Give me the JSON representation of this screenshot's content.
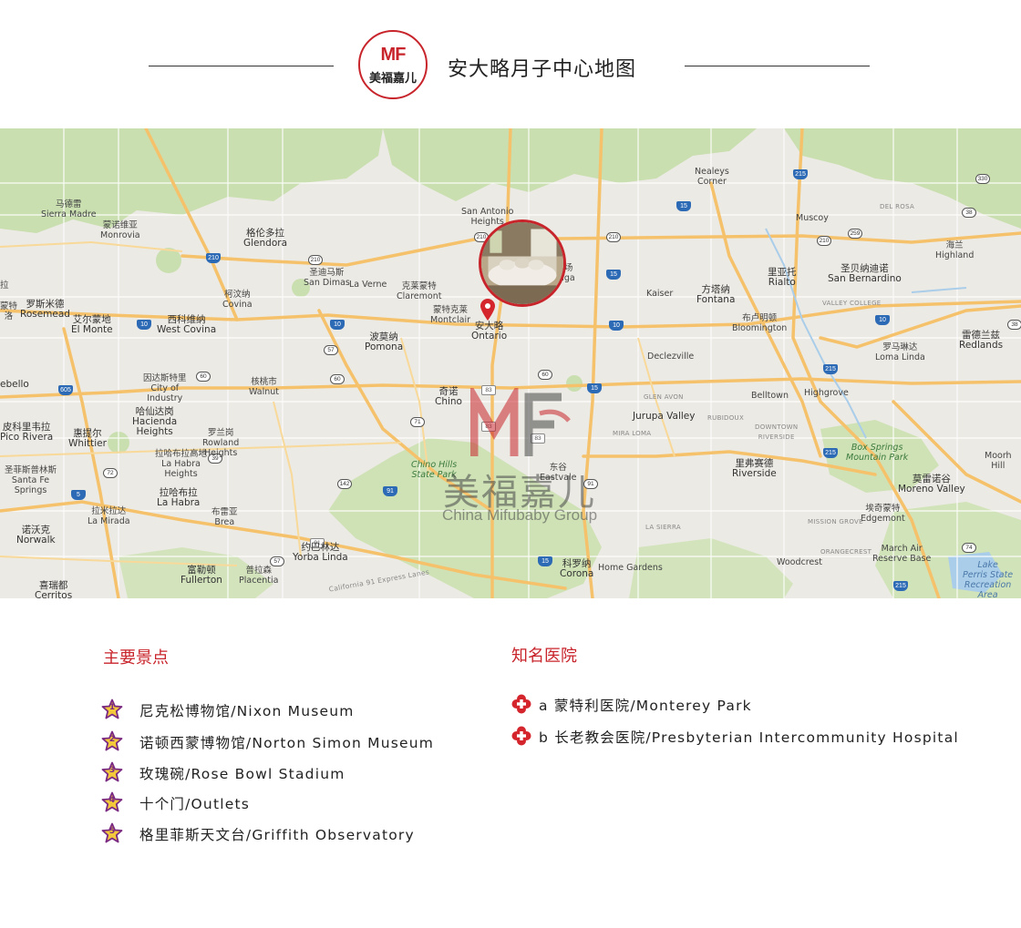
{
  "header": {
    "logo_mark": "MF",
    "logo_text": "美福嘉儿",
    "title": "安大略月子中心地图"
  },
  "map": {
    "marker_label_cn": "安大略",
    "marker_label_en": "Ontario",
    "watermark_cn": "美福嘉儿",
    "watermark_en": "China Mifubaby Group",
    "places": {
      "nealeys_corner": "Nealeys\nCorner",
      "sierra_madre": "马德雷\nSierra Madre",
      "monrovia": "蒙诺维亚\nMonrovia",
      "glendora": "格伦多拉\nGlendora",
      "san_antonio_heights": "San Antonio\nHeights",
      "muscoy": "Muscoy",
      "del_rosa": "DEL ROSA",
      "highland": "海兰\nHighland",
      "san_dimas": "圣迪马斯\nSan Dimas",
      "la_verne": "La Verne",
      "claremont": "克莱蒙特\nClaremont",
      "covina": "柯汶纳\nCovina",
      "montclair": "蒙特克莱\nMontclair",
      "upland_partial": "牧场\nonga",
      "kaiser": "Kaiser",
      "fontana": "方塔纳\nFontana",
      "rialto": "里亚托\nRialto",
      "san_bernardino": "圣贝纳迪诺\nSan Bernardino",
      "valley_college": "VALLEY COLLEGE",
      "la_puente_partial": "拉",
      "rosemead": "罗斯米德\nRosemead",
      "el_monte": "艾尔蒙地\nEl Monte",
      "west_covina": "西科维纳\nWest Covina",
      "pomona": "波莫纳\nPomona",
      "bloomington": "布卢明顿\nBloomington",
      "redlands": "雷德兰兹\nRedlands",
      "loma_linda": "罗马琳达\nLoma Linda",
      "declezville": "Declezville",
      "city_of_industry": "因达斯特里\nCity of\nIndustry",
      "walnut": "核桃市\nWalnut",
      "chino": "奇诺\nChino",
      "glen_avon": "GLEN AVON",
      "belltown": "Belltown",
      "highgrove": "Highgrove",
      "pico_rivera": "皮科里韦拉\nPico Rivera",
      "whittier": "惠提尔\nWhittier",
      "hacienda_heights": "哈仙达岗\nHacienda\nHeights",
      "rowland_heights": "罗兰岗\nRowland\nHeights",
      "jurupa_valley": "Jurupa Valley",
      "rubidoux": "RUBIDOUX",
      "mira_loma": "MIRA LOMA",
      "downtown_riverside": "DOWNTOWN\nRIVERSIDE",
      "box_springs": "Box Springs\nMountain Park",
      "moorpark_partial": "Moorh\nHill",
      "santa_fe_springs": "圣菲斯普林斯\nSanta Fe\nSprings",
      "la_habra_heights": "拉哈布拉高地\nLa Habra\nHeights",
      "chino_hills": "Chino Hills\nState Park",
      "eastvale": "东谷\nEastvale",
      "riverside": "里弗赛德\nRiverside",
      "moreno_valley": "莫雷诺谷\nMoreno Valley",
      "la_habra": "拉哈布拉\nLa Habra",
      "la_mirada": "拉米拉达\nLa Mirada",
      "brea": "布雷亚\nBrea",
      "edgemont": "埃奇蒙特\nEdgemont",
      "mission_grove": "MISSION GROVE",
      "la_sierra": "LA SIERRA",
      "norwalk": "诺沃克\nNorwalk",
      "yorba_linda": "约巴林达\nYorba Linda",
      "orangecrest": "ORANGECREST",
      "march_air": "March Air\nReserve Base",
      "fullerton": "富勒顿\nFullerton",
      "placentia": "普拉森\nPlacentia",
      "corona": "科罗纳\nCorona",
      "home_gardens": "Home Gardens",
      "woodcrest": "Woodcrest",
      "lake_perris": "Lake\nPerris State\nRecreation\nArea",
      "cerritos": "喜瑞都\nCerritos",
      "la_partial": "ebello",
      "montebello_partial": "蒙特\n洛",
      "california_91": "California 91 Express Lanes"
    }
  },
  "attractions": {
    "title": "主要景点",
    "items": [
      {
        "num": "1",
        "label": "尼克松博物馆/Nixon Museum"
      },
      {
        "num": "2",
        "label": "诺顿西蒙博物馆/Norton Simon Museum"
      },
      {
        "num": "3",
        "label": "玫瑰碗/Rose Bowl Stadium"
      },
      {
        "num": "4",
        "label": "十个门/Outlets"
      },
      {
        "num": "5",
        "label": "格里菲斯天文台/Griffith Observatory"
      }
    ]
  },
  "hospitals": {
    "title": "知名医院",
    "items": [
      {
        "letter": "a",
        "label": "蒙特利医院/Monterey Park"
      },
      {
        "letter": "b",
        "label": "长老教会医院/Presbyterian Intercommunity Hospital"
      }
    ]
  },
  "colors": {
    "accent": "#c8242b",
    "star_fill": "#f3c83a",
    "star_outline": "#7a2a82",
    "map_bg": "#eceae4",
    "park_green": "#c9dfb0",
    "highway": "#f5c26b"
  }
}
